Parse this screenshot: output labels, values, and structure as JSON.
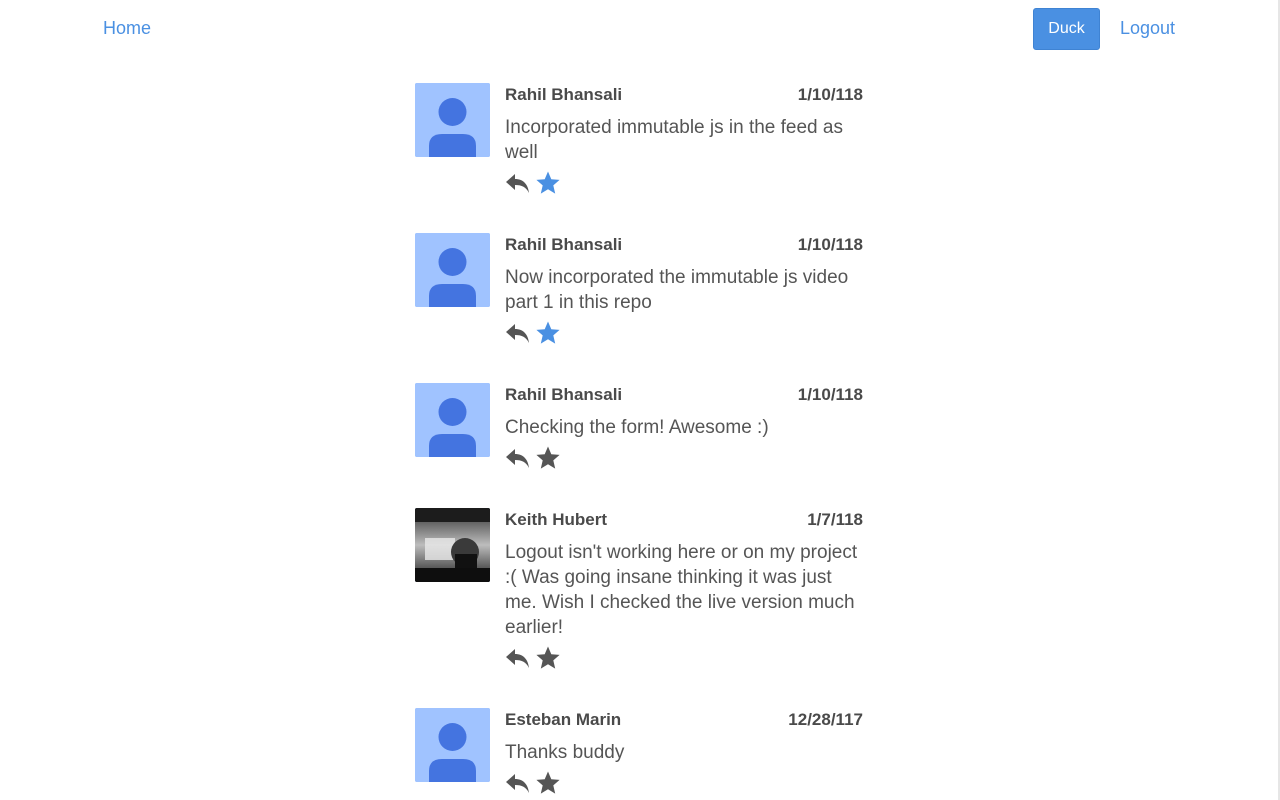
{
  "nav": {
    "home_label": "Home",
    "duck_label": "Duck",
    "logout_label": "Logout"
  },
  "colors": {
    "accent": "#4a90e2",
    "icon_gray": "#555555",
    "avatar_bg": "#a0c3ff",
    "avatar_fg": "#4474e0"
  },
  "feed": [
    {
      "author": "Rahil Bhansali",
      "date": "1/10/118",
      "text": "Incorporated immutable js in the feed as well",
      "avatar": "default-avatar",
      "liked": true
    },
    {
      "author": "Rahil Bhansali",
      "date": "1/10/118",
      "text": "Now incorporated the immutable js video part 1 in this repo",
      "avatar": "default-avatar",
      "liked": true
    },
    {
      "author": "Rahil Bhansali",
      "date": "1/10/118",
      "text": "Checking the form! Awesome :)",
      "avatar": "default-avatar",
      "liked": false
    },
    {
      "author": "Keith Hubert",
      "date": "1/7/118",
      "text": "Logout isn't working here or on my project :( Was going insane thinking it was just me. Wish I checked the live version much earlier!",
      "avatar": "photo-avatar",
      "liked": false
    },
    {
      "author": "Esteban Marin",
      "date": "12/28/117",
      "text": "Thanks buddy",
      "avatar": "default-avatar",
      "liked": false
    }
  ]
}
